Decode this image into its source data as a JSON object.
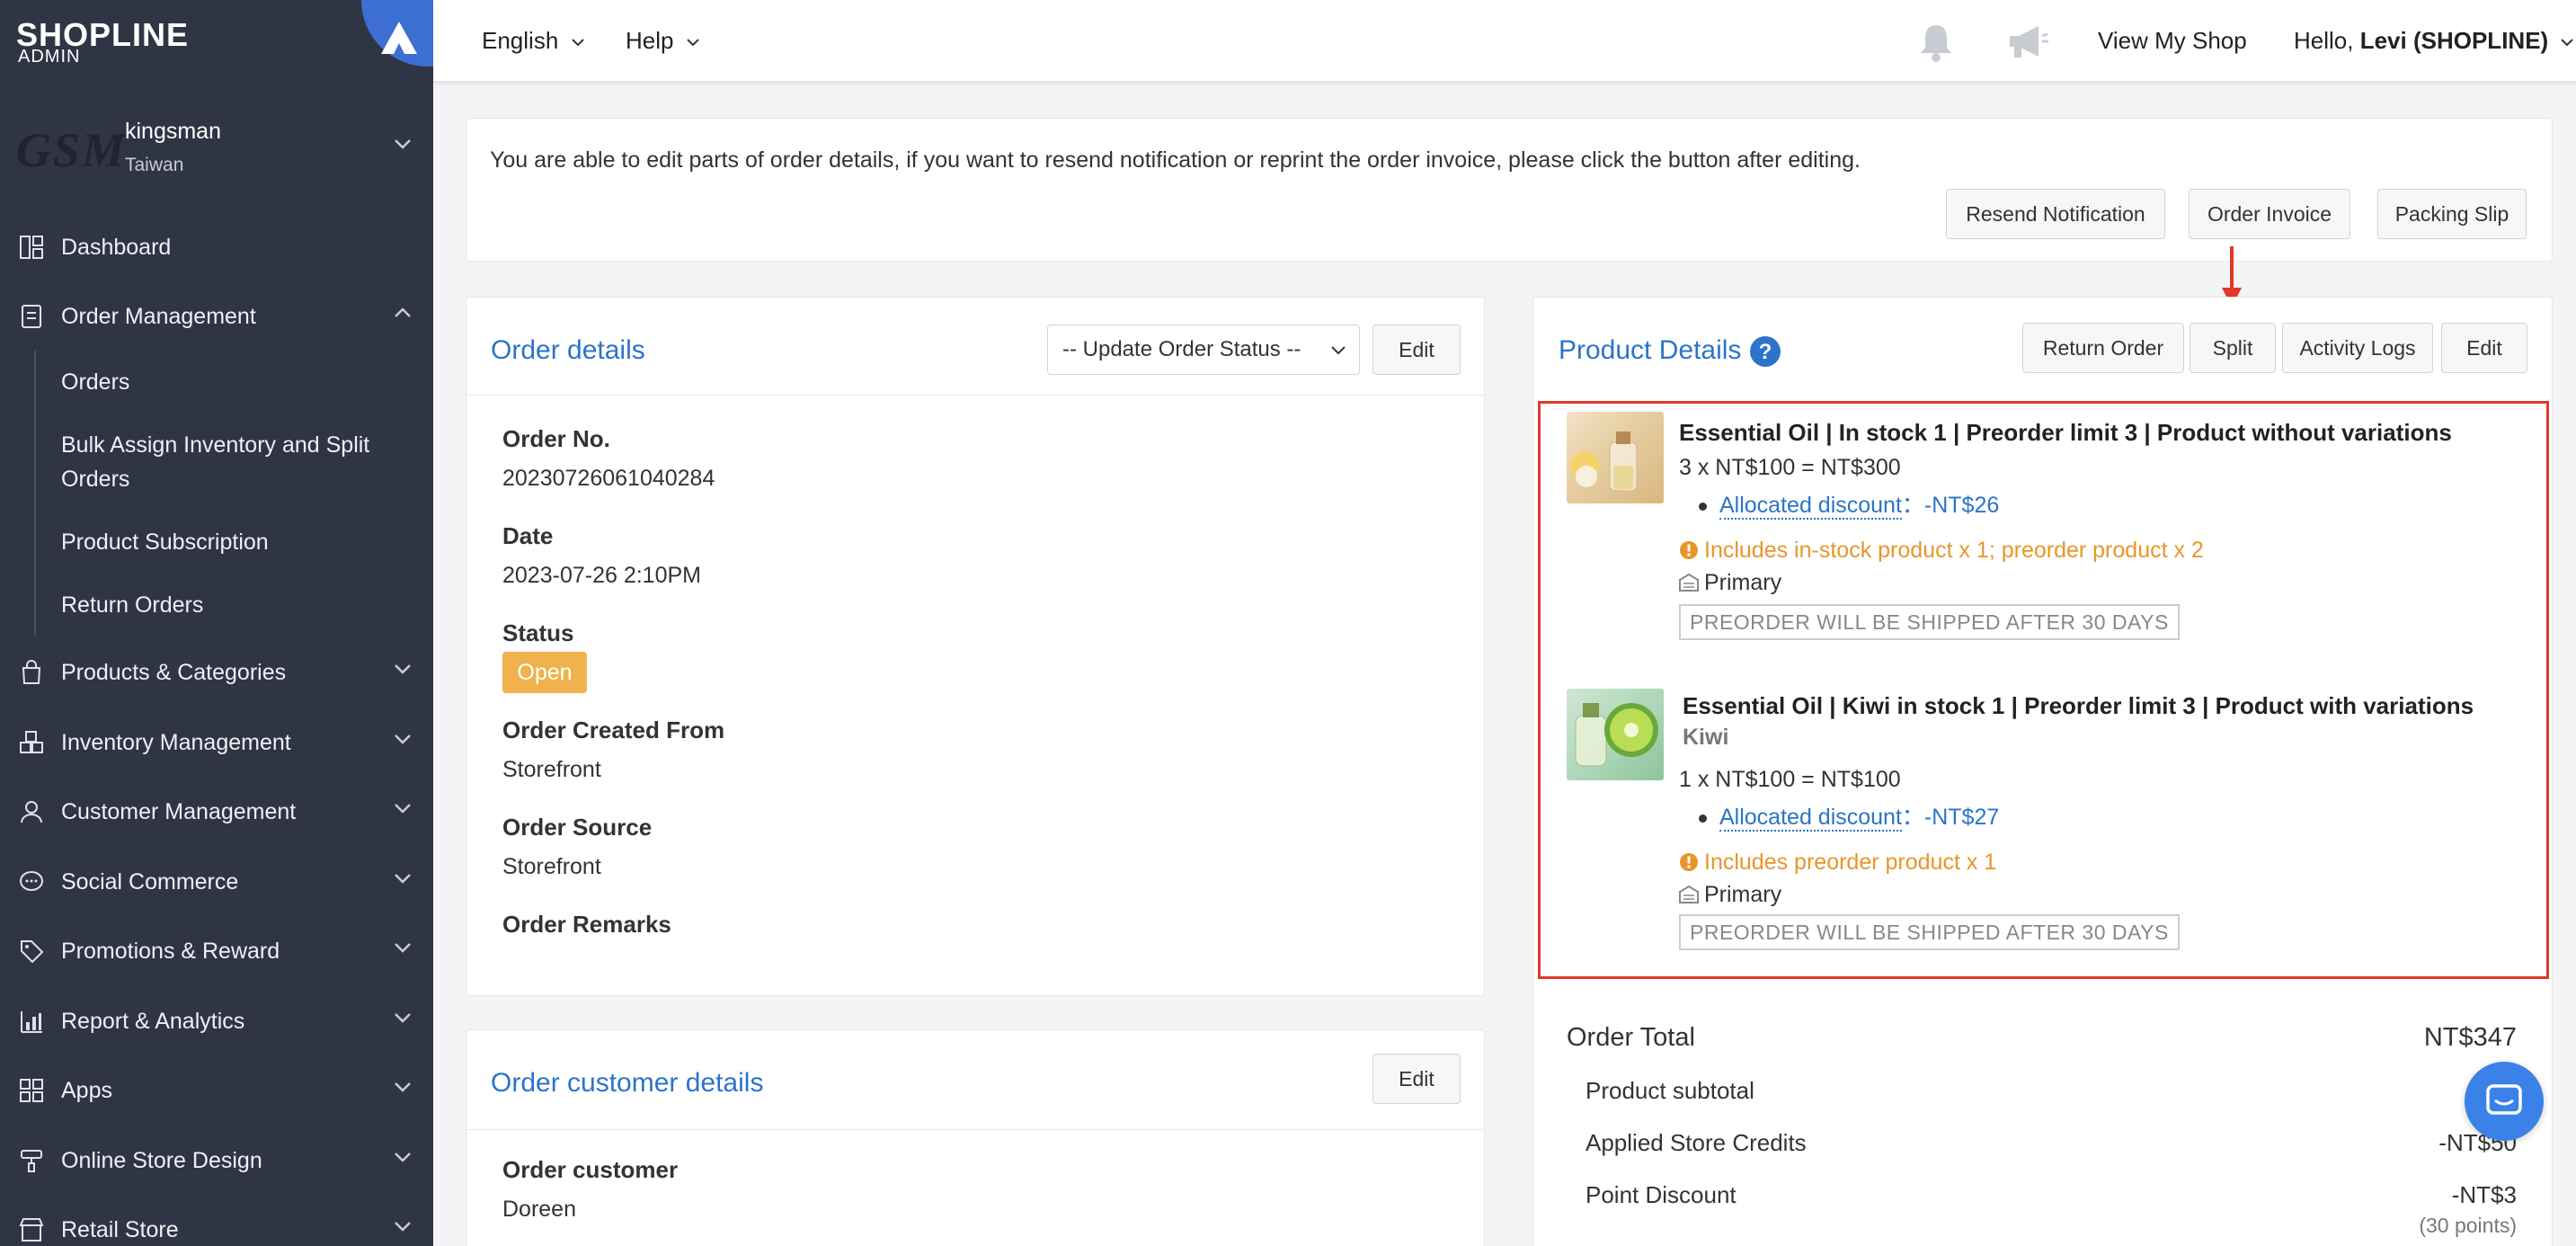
{
  "sidebar": {
    "logo": "SHOPLINE",
    "logo_sub": "ADMIN",
    "store_logo": "GSM",
    "store_name": "kingsman",
    "store_region": "Taiwan",
    "items": [
      {
        "label": "Dashboard",
        "icon": "dashboard-icon"
      },
      {
        "label": "Order Management",
        "icon": "order-icon"
      },
      {
        "label": "Products & Categories",
        "icon": "bag-icon"
      },
      {
        "label": "Inventory Management",
        "icon": "inventory-icon"
      },
      {
        "label": "Customer Management",
        "icon": "user-icon"
      },
      {
        "label": "Social Commerce",
        "icon": "chat-icon"
      },
      {
        "label": "Promotions & Reward",
        "icon": "tag-icon"
      },
      {
        "label": "Report & Analytics",
        "icon": "chart-icon"
      },
      {
        "label": "Apps",
        "icon": "apps-icon"
      },
      {
        "label": "Online Store Design",
        "icon": "brush-icon"
      },
      {
        "label": "Retail Store",
        "icon": "store-icon"
      }
    ],
    "order_sub": [
      "Orders",
      "Bulk Assign Inventory and Split Orders",
      "Product Subscription",
      "Return Orders"
    ]
  },
  "topbar": {
    "language": "English",
    "help": "Help",
    "view_shop": "View My Shop",
    "hello": "Hello,",
    "user": "Levi (SHOPLINE)"
  },
  "notice": {
    "text": "You are able to edit parts of order details, if you want to resend notification or reprint the order invoice, please click the button after editing.",
    "resend": "Resend Notification",
    "invoice": "Order Invoice",
    "packing": "Packing Slip"
  },
  "order_details": {
    "title": "Order details",
    "status_select": "-- Update Order Status --",
    "edit": "Edit",
    "order_no_label": "Order No.",
    "order_no": "20230726061040284",
    "date_label": "Date",
    "date": "2023-07-26 2:10PM",
    "status_label": "Status",
    "status": "Open",
    "created_from_label": "Order Created From",
    "created_from": "Storefront",
    "source_label": "Order Source",
    "source": "Storefront",
    "remarks_label": "Order Remarks"
  },
  "customer_details": {
    "title": "Order customer details",
    "edit": "Edit",
    "customer_label": "Order customer",
    "customer": "Doreen"
  },
  "product_details": {
    "title": "Product Details",
    "return": "Return Order",
    "split": "Split",
    "logs": "Activity Logs",
    "edit": "Edit",
    "items": [
      {
        "title": "Essential Oil | In stock 1 | Preorder limit 3 | Product without variations",
        "variation": "",
        "price": "3 x NT$100 = NT$300",
        "discount_label": "Allocated discount",
        "discount": "：-NT$26",
        "warning": "Includes in-stock product x 1; preorder product x 2",
        "location": "Primary",
        "preorder": "PREORDER WILL BE SHIPPED AFTER 30 DAYS"
      },
      {
        "title": "Essential Oil | Kiwi in stock 1 | Preorder limit 3 | Product with variations",
        "variation": "Kiwi",
        "price": "1 x NT$100 = NT$100",
        "discount_label": "Allocated discount",
        "discount": "：-NT$27",
        "warning": "Includes preorder product x 1",
        "location": "Primary",
        "preorder": "PREORDER WILL BE SHIPPED AFTER 30 DAYS"
      }
    ]
  },
  "summary": {
    "total_label": "Order Total",
    "total": "NT$347",
    "subtotal_label": "Product subtotal",
    "subtotal": "NT$",
    "credits_label": "Applied Store Credits",
    "credits": "-NT$50",
    "points_label": "Point Discount",
    "points": "-NT$3",
    "points_note": "(30 points)"
  },
  "colors": {
    "sidebar": "#2f3545",
    "accent": "#2b74c9",
    "warning": "#e8962a",
    "highlight": "#e0392b",
    "badge": "#f0b24c"
  }
}
